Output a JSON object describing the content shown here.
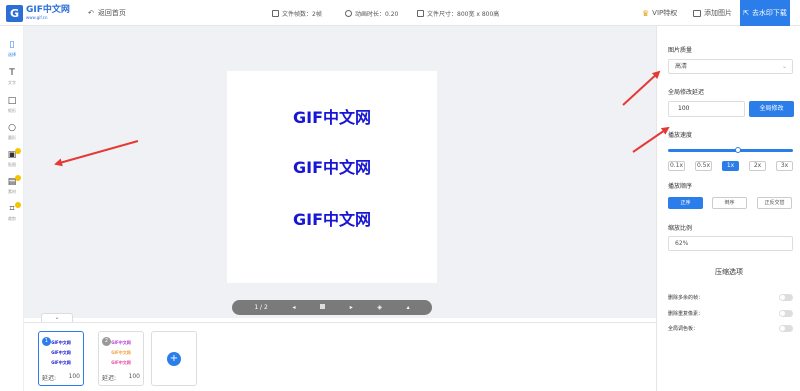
{
  "topbar": {
    "logo_main": "GIF中文网",
    "logo_sub": "www.gif.cn",
    "back_label": "返回首页",
    "frame_count": "文件帧数：2帧",
    "duration": "动画时长：0.20",
    "size": "文件尺寸：800宽 x 800高",
    "vip_label": "VIP特权",
    "add_image_label": "添加图片",
    "download_label": "去水印下载"
  },
  "tools": [
    {
      "label": "选择",
      "glyph": "▯"
    },
    {
      "label": "文字",
      "glyph": "T"
    },
    {
      "label": "矩形",
      "glyph": "□"
    },
    {
      "label": "圆形",
      "glyph": "○"
    },
    {
      "label": "贴图",
      "glyph": "▣"
    },
    {
      "label": "素材",
      "glyph": "▤"
    },
    {
      "label": "裁剪",
      "glyph": "⌗"
    }
  ],
  "canvas": {
    "lines": [
      "GIF中文网",
      "GIF中文网",
      "GIF中文网"
    ],
    "page_indicator": "1 / 2",
    "collapse_glyph": "⌄"
  },
  "frames": [
    {
      "num": "1",
      "lines": [
        "GIF中文网",
        "GIF中文网",
        "GIF中文网"
      ],
      "delay_label": "延迟:",
      "delay": "100"
    },
    {
      "num": "2",
      "lines": [
        "GIF中文网",
        "GIF中文网",
        "GIF中文网"
      ],
      "delay_label": "延迟:",
      "delay": "100"
    }
  ],
  "add_frame_glyph": "+",
  "panel": {
    "quality_label": "图片质量",
    "quality_value": "高清",
    "delay_label": "全局修改延迟",
    "delay_value": "100",
    "delay_button": "全局修改",
    "speed_label": "播放速度",
    "speed_value": 0.56,
    "speeds": [
      "0.1x",
      "0.5x",
      "1x",
      "2x",
      "3x"
    ],
    "order_label": "播放顺序",
    "orders": [
      "正序",
      "倒序",
      "正反交替"
    ],
    "scale_label": "缩放比例",
    "scale_value": "62%",
    "compress_title": "压缩选项",
    "options": [
      "删除多余的帧：",
      "删除重复像素：",
      "全局调色板："
    ]
  },
  "colors": {
    "accent": "#2b7de9",
    "art_text": "#1616d4",
    "arrow": "#e53935"
  }
}
